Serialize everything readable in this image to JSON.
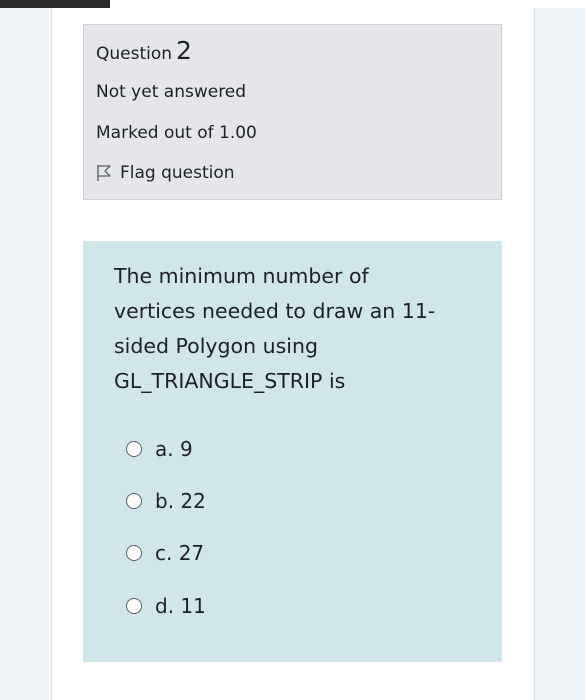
{
  "question": {
    "label": "Question",
    "number": "2",
    "status": "Not yet answered",
    "marks": "Marked out of 1.00",
    "flag_label": "Flag question",
    "flag_icon": "flag-outline-icon"
  },
  "prompt": {
    "lines": [
      "The minimum number of",
      "vertices needed to draw an 11-",
      "sided Polygon using",
      "GL_TRIANGLE_STRIP is"
    ]
  },
  "options": [
    {
      "label": "a. 9",
      "selected": false
    },
    {
      "label": "b. 22",
      "selected": false
    },
    {
      "label": "c. 27",
      "selected": false
    },
    {
      "label": "d. 11",
      "selected": false
    }
  ],
  "colors": {
    "info_bg": "#e4e6e9",
    "question_bg": "#cfe6eb",
    "gutter_bg": "#eef3f7"
  }
}
